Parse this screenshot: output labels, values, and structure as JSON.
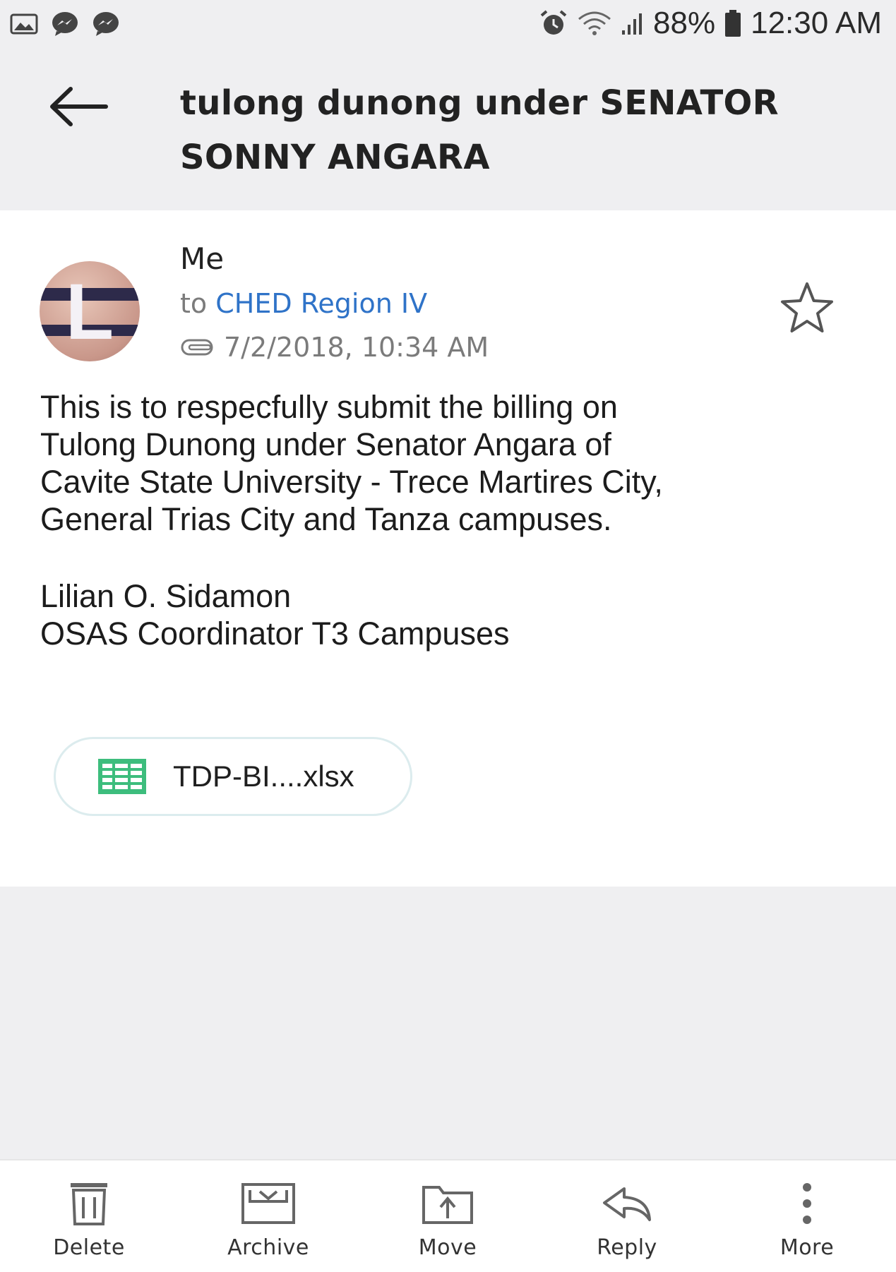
{
  "status_bar": {
    "battery_percent": "88%",
    "time": "12:30 AM",
    "left_icons": [
      "image-notification-icon",
      "messenger-icon",
      "messenger-icon"
    ],
    "right_icons": [
      "alarm-icon",
      "wifi-icon",
      "signal-icon",
      "battery-icon"
    ]
  },
  "header": {
    "subject_line1": "tulong dunong under SENATOR",
    "subject_line2": "SONNY ANGARA",
    "back_icon": "back-arrow-icon"
  },
  "message": {
    "avatar_letter": "L",
    "sender": "Me",
    "to_prefix": "to",
    "recipient": "CHED Region IV",
    "date": "7/2/2018, 10:34 AM",
    "attachment_indicator_icon": "attachment-link-icon",
    "star_icon": "star-outline-icon",
    "body_lines": [
      "This is to respecfully submit the  billing on",
      "Tulong Dunong under Senator Angara of",
      "Cavite State University - Trece Martires City,",
      "General Trias City and Tanza campuses."
    ],
    "signature_name": "Lilian O. Sidamon",
    "signature_title": "OSAS Coordinator T3 Campuses",
    "attachment": {
      "name": "TDP-BI....xlsx",
      "icon": "spreadsheet-icon",
      "icon_color": "#3dbd7d"
    }
  },
  "toolbar": {
    "delete": "Delete",
    "archive": "Archive",
    "move": "Move",
    "reply": "Reply",
    "more": "More"
  },
  "colors": {
    "link": "#2f73c8",
    "background": "#efeff1",
    "card": "#ffffff"
  }
}
